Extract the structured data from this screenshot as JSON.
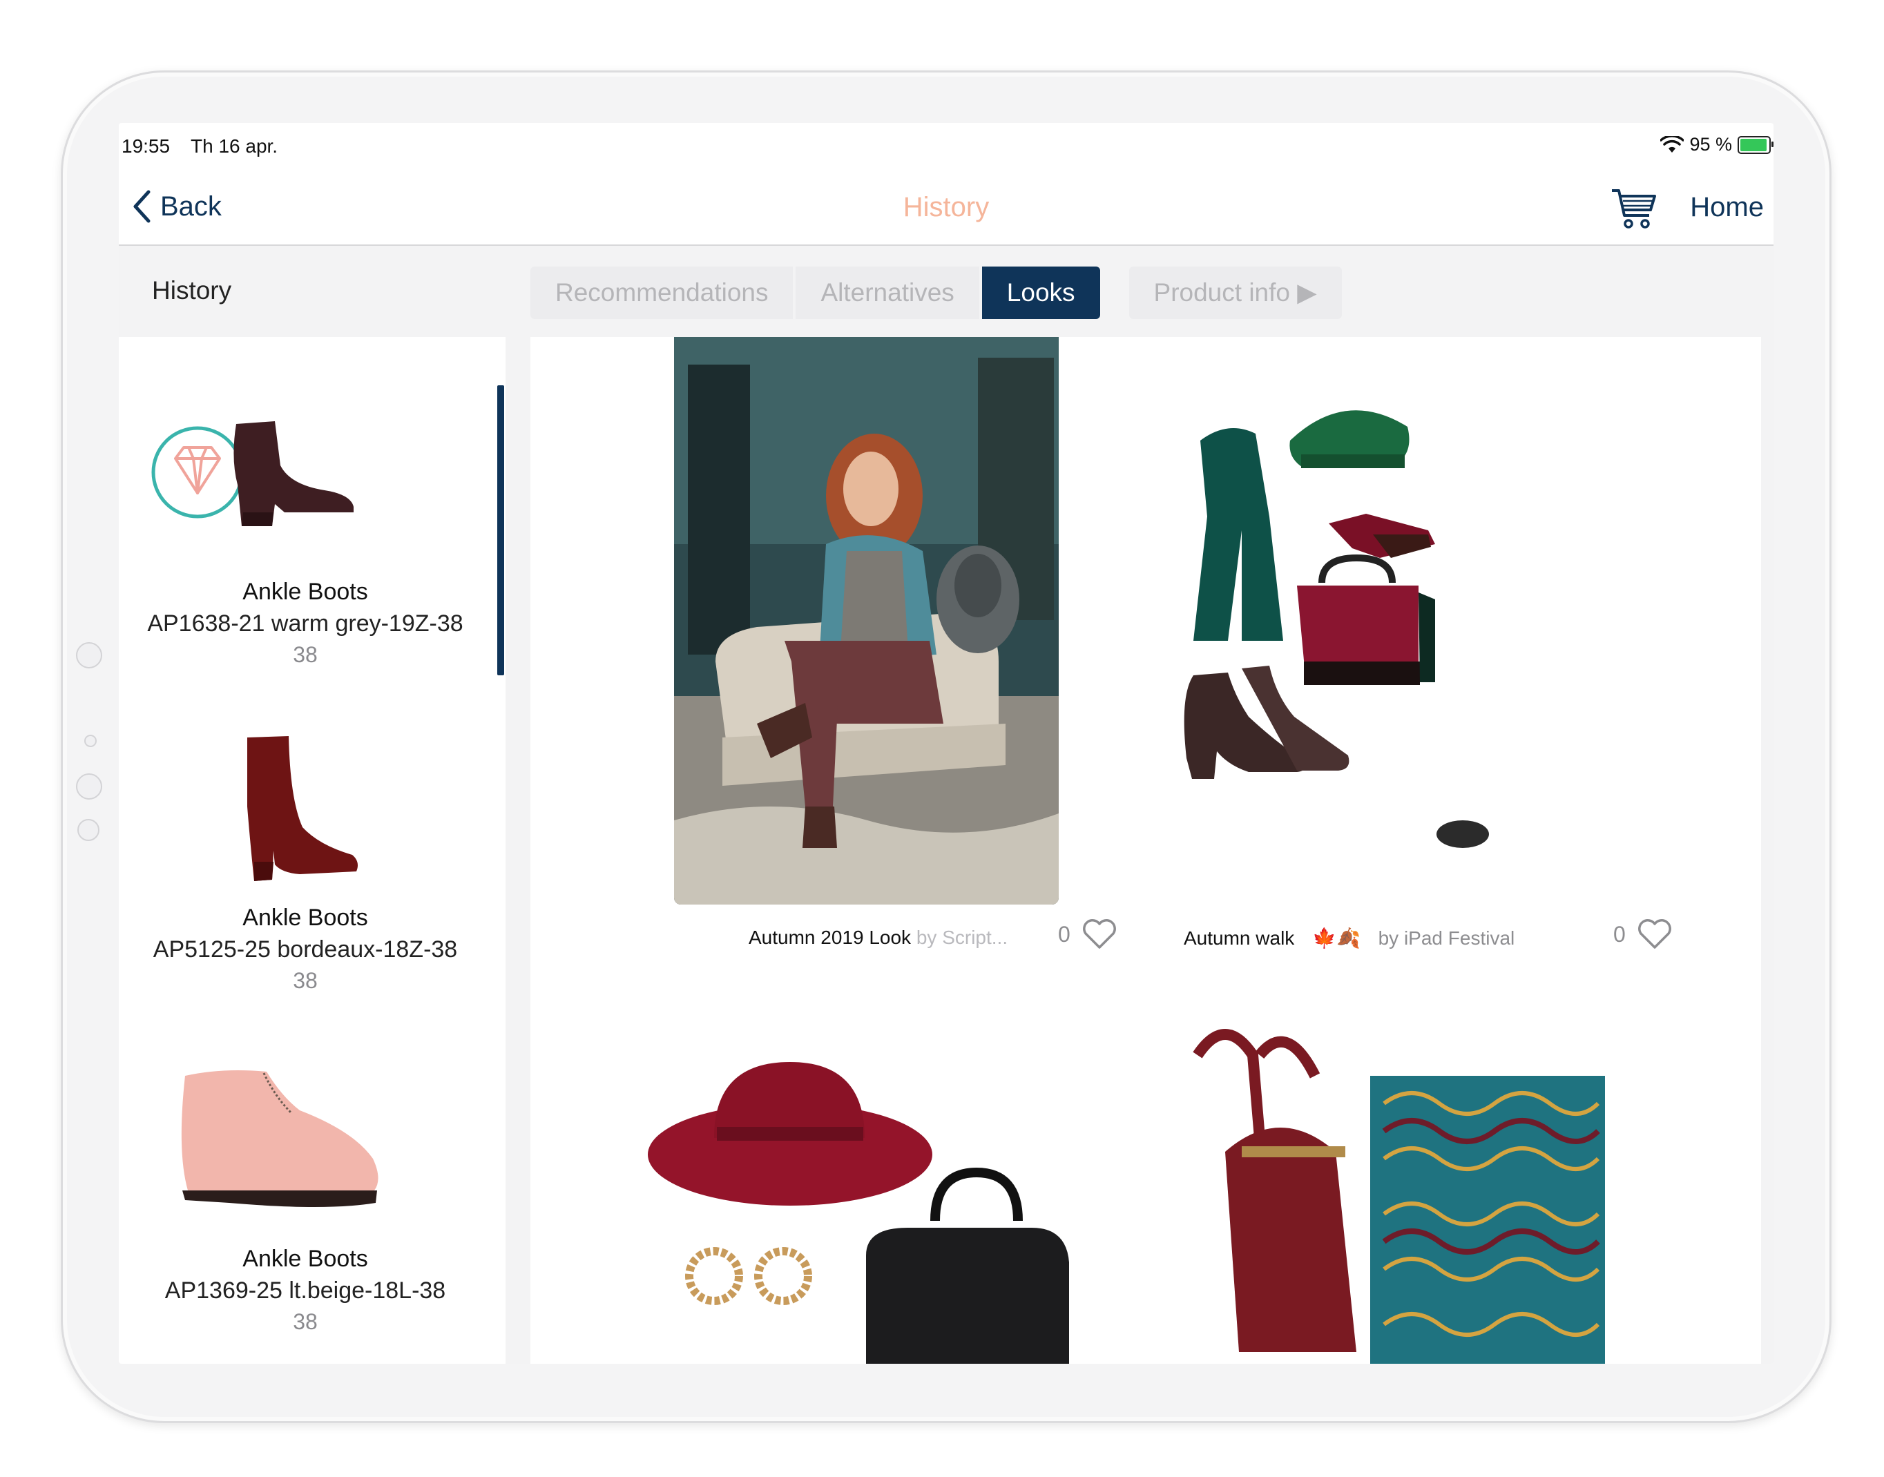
{
  "status_bar": {
    "time": "19:55",
    "date": "Th 16 apr.",
    "battery": "95 %"
  },
  "nav": {
    "back_label": "Back",
    "title": "History",
    "home_label": "Home"
  },
  "sidebar_title": "History",
  "tabs": [
    {
      "label": "Recommendations",
      "active": false
    },
    {
      "label": "Alternatives",
      "active": false
    },
    {
      "label": "Looks",
      "active": true
    },
    {
      "label": "Product info ▶",
      "active": false
    }
  ],
  "history_items": [
    {
      "name": "Ankle Boots",
      "sku": "AP1638-21 warm grey-19Z-38",
      "size": "38",
      "badge": "diamond-icon",
      "color": "#3e1e22"
    },
    {
      "name": "Ankle Boots",
      "sku": "AP5125-25 bordeaux-18Z-38",
      "size": "38",
      "color": "#6e1414"
    },
    {
      "name": "Ankle Boots",
      "sku": "AP1369-25 lt.beige-18L-38",
      "size": "38",
      "color": "#f2b6ac"
    }
  ],
  "looks": [
    {
      "title": "Autumn 2019 Look",
      "author": "by Script...",
      "likes": "0"
    },
    {
      "title": "Autumn walk",
      "emoji": "🍁🍂",
      "author": "by iPad Festival",
      "likes": "0"
    }
  ],
  "colors": {
    "accent": "#0f3459",
    "title_accent": "#f5b59a",
    "badge_ring": "#3ab4ac"
  }
}
